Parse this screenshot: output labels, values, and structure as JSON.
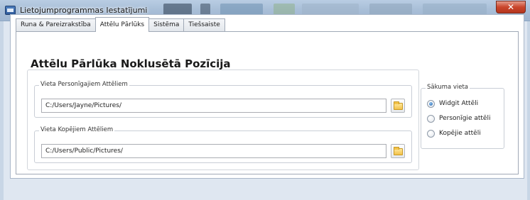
{
  "window": {
    "title": "Lietojumprogrammas Iestatījumi"
  },
  "tabs": [
    {
      "label": "Runa & Pareizrakstība",
      "active": false
    },
    {
      "label": "Attēlu Pārlūks",
      "active": true
    },
    {
      "label": "Sistēma",
      "active": false
    },
    {
      "label": "Tiešsaiste",
      "active": false
    }
  ],
  "panel": {
    "heading": "Attēlu Pārlūka Noklusētā Pozīcija",
    "personal_group": {
      "label": "Vieta Personīgajiem Attēliem",
      "value": "C:/Users/Jayne/Pictures/"
    },
    "copies_group": {
      "label": "Vieta Kopējiem Attēliem",
      "value": "C:/Users/Public/Pictures/"
    },
    "start_location": {
      "label": "Sākuma vieta",
      "options": [
        {
          "label": "Widgit Attēli",
          "checked": true
        },
        {
          "label": "Personīgie attēli",
          "checked": false
        },
        {
          "label": "Kopējie attēli",
          "checked": false
        }
      ]
    }
  },
  "icons": {
    "app": "app-window-icon",
    "folder": "folder-icon",
    "close": "close-icon"
  },
  "colors": {
    "titlebar": "#a9bfd8",
    "close_button": "#c9462c",
    "radio_selected": "#1f5fa8"
  }
}
